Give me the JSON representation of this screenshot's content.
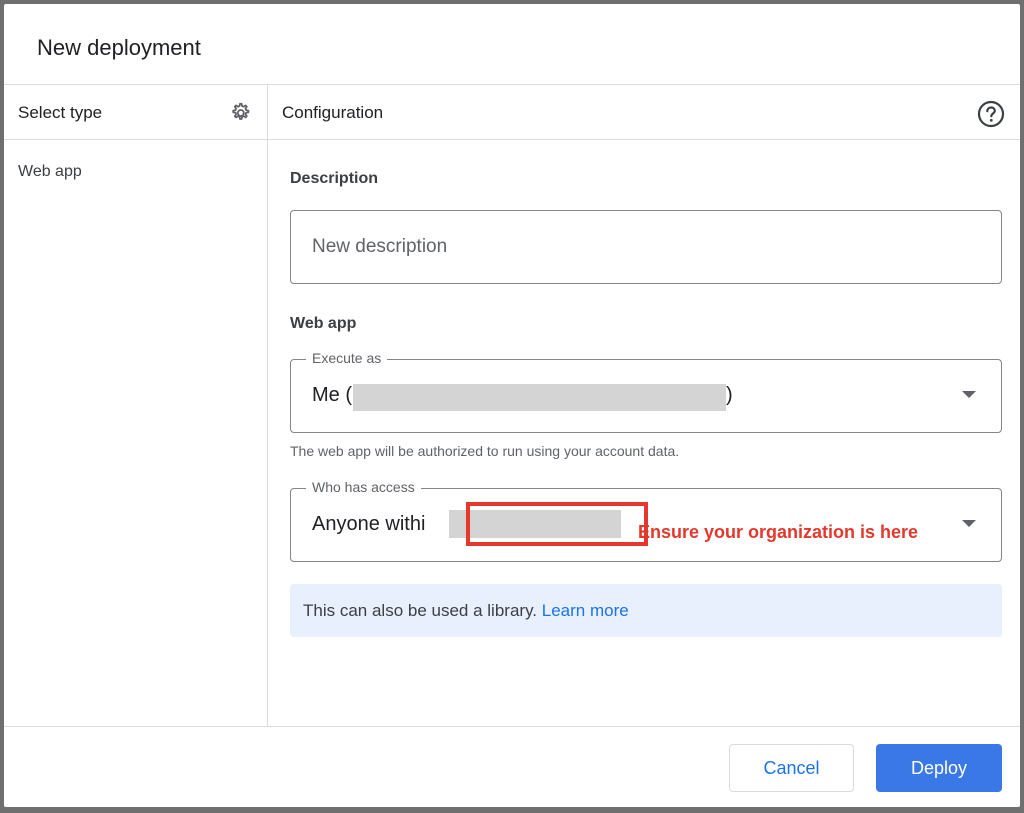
{
  "dialog": {
    "title": "New deployment"
  },
  "left_pane": {
    "header": "Select type",
    "settings_icon": "gear-icon",
    "items": [
      {
        "label": "Web app"
      }
    ]
  },
  "right_pane": {
    "header": "Configuration",
    "help_icon": "help-circle-icon",
    "description": {
      "label": "Description",
      "value": "",
      "placeholder": "New description"
    },
    "web_app": {
      "label": "Web app",
      "execute_as": {
        "label": "Execute as",
        "value_prefix": "Me (",
        "value_suffix": ")"
      },
      "execute_helper": "The web app will be authorized to run using your account data.",
      "who_has_access": {
        "label": "Who has access",
        "value_prefix": "Anyone withi"
      },
      "annotation": "Ensure your organization is here"
    },
    "info": {
      "text": "This can also be used a library. ",
      "link": "Learn more"
    }
  },
  "footer": {
    "cancel_label": "Cancel",
    "deploy_label": "Deploy"
  },
  "colors": {
    "accent": "#1a73e8",
    "deploy_button": "#3b78e7",
    "annotation_red": "#e3382b",
    "info_background": "#e8f0fe"
  }
}
